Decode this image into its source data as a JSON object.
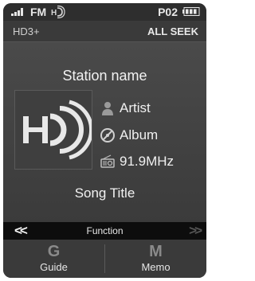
{
  "status_bar": {
    "band": "FM",
    "preset": "P02",
    "signal_icon": "signal-bars-icon",
    "hd_icon": "hd-radio-icon",
    "battery_icon": "battery-icon"
  },
  "info_row": {
    "hd_channel": "HD3+",
    "seek_mode": "ALL SEEK"
  },
  "now_playing": {
    "station": "Station name",
    "artist": "Artist",
    "album": "Album",
    "frequency": "91.9MHz",
    "song_title": "Song Title",
    "logo_icon": "hd-radio-logo"
  },
  "function_bar": {
    "prev_symbol": "<<",
    "label": "Function",
    "next_symbol": ">>"
  },
  "softkeys": [
    {
      "key": "G",
      "label": "Guide"
    },
    {
      "key": "M",
      "label": "Memo"
    }
  ],
  "colors": {
    "background": "#2b2b2b",
    "text": "#f2f2f2",
    "function_bar": "#0d0d0d"
  }
}
